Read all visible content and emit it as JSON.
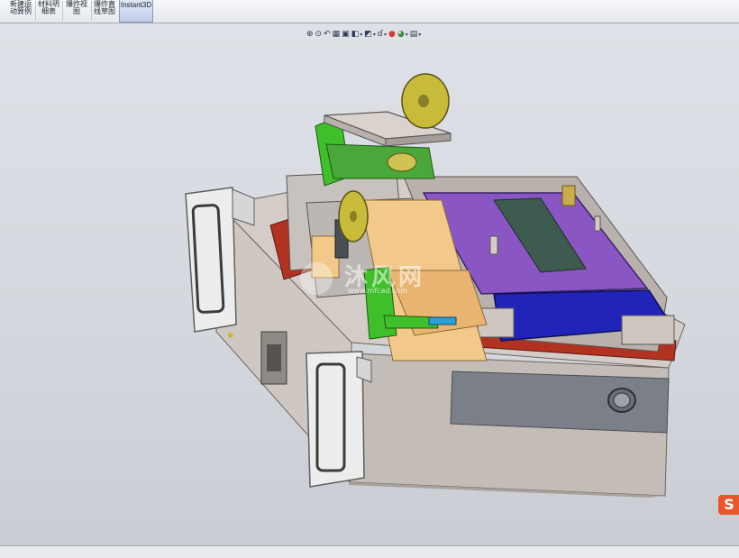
{
  "ribbon": {
    "items": [
      {
        "line1": "新建运",
        "line2": "动算例"
      },
      {
        "line1": "材料明",
        "line2": "细表"
      },
      {
        "line1": "爆炸视",
        "line2": "图"
      },
      {
        "line1": "爆炸直",
        "line2": "线草图"
      },
      {
        "line1": "Instant3D",
        "line2": ""
      }
    ]
  },
  "view_toolbar": {
    "items": [
      {
        "icon": "zoom-to-fit-icon",
        "glyph": "⊕"
      },
      {
        "icon": "zoom-to-area-icon",
        "glyph": "⊙"
      },
      {
        "icon": "previous-view-icon",
        "glyph": "↶"
      },
      {
        "icon": "section-view-icon",
        "glyph": "▦"
      },
      {
        "icon": "dynamic-annotation-icon",
        "glyph": "▣"
      },
      {
        "icon": "view-orientation-icon",
        "glyph": "◧",
        "dropdown": "▾"
      },
      {
        "icon": "display-style-icon",
        "glyph": "◩",
        "dropdown": "▾"
      },
      {
        "icon": "hide-show-items-icon",
        "glyph": "ɗ",
        "dropdown": "▾"
      },
      {
        "icon": "edit-appearance-icon",
        "glyph": "●"
      },
      {
        "icon": "apply-scene-icon",
        "glyph": "◕",
        "dropdown": "▾"
      },
      {
        "icon": "view-settings-icon",
        "glyph": "▤",
        "dropdown": "▾"
      }
    ]
  },
  "watermark": {
    "text": "沐风网",
    "url": "www.mfcad.com"
  },
  "corner_badge": {
    "text": "S"
  },
  "colors": {
    "viewport_bg": "#d8dbe1",
    "frame_green": "#3fbf2a",
    "plate_gray": "#c4bcb6",
    "wood": "#f2c98a",
    "purple": "#8a56c4",
    "blue": "#2124b8",
    "red": "#b23221",
    "yellow_wheel": "#c9bb3a"
  }
}
